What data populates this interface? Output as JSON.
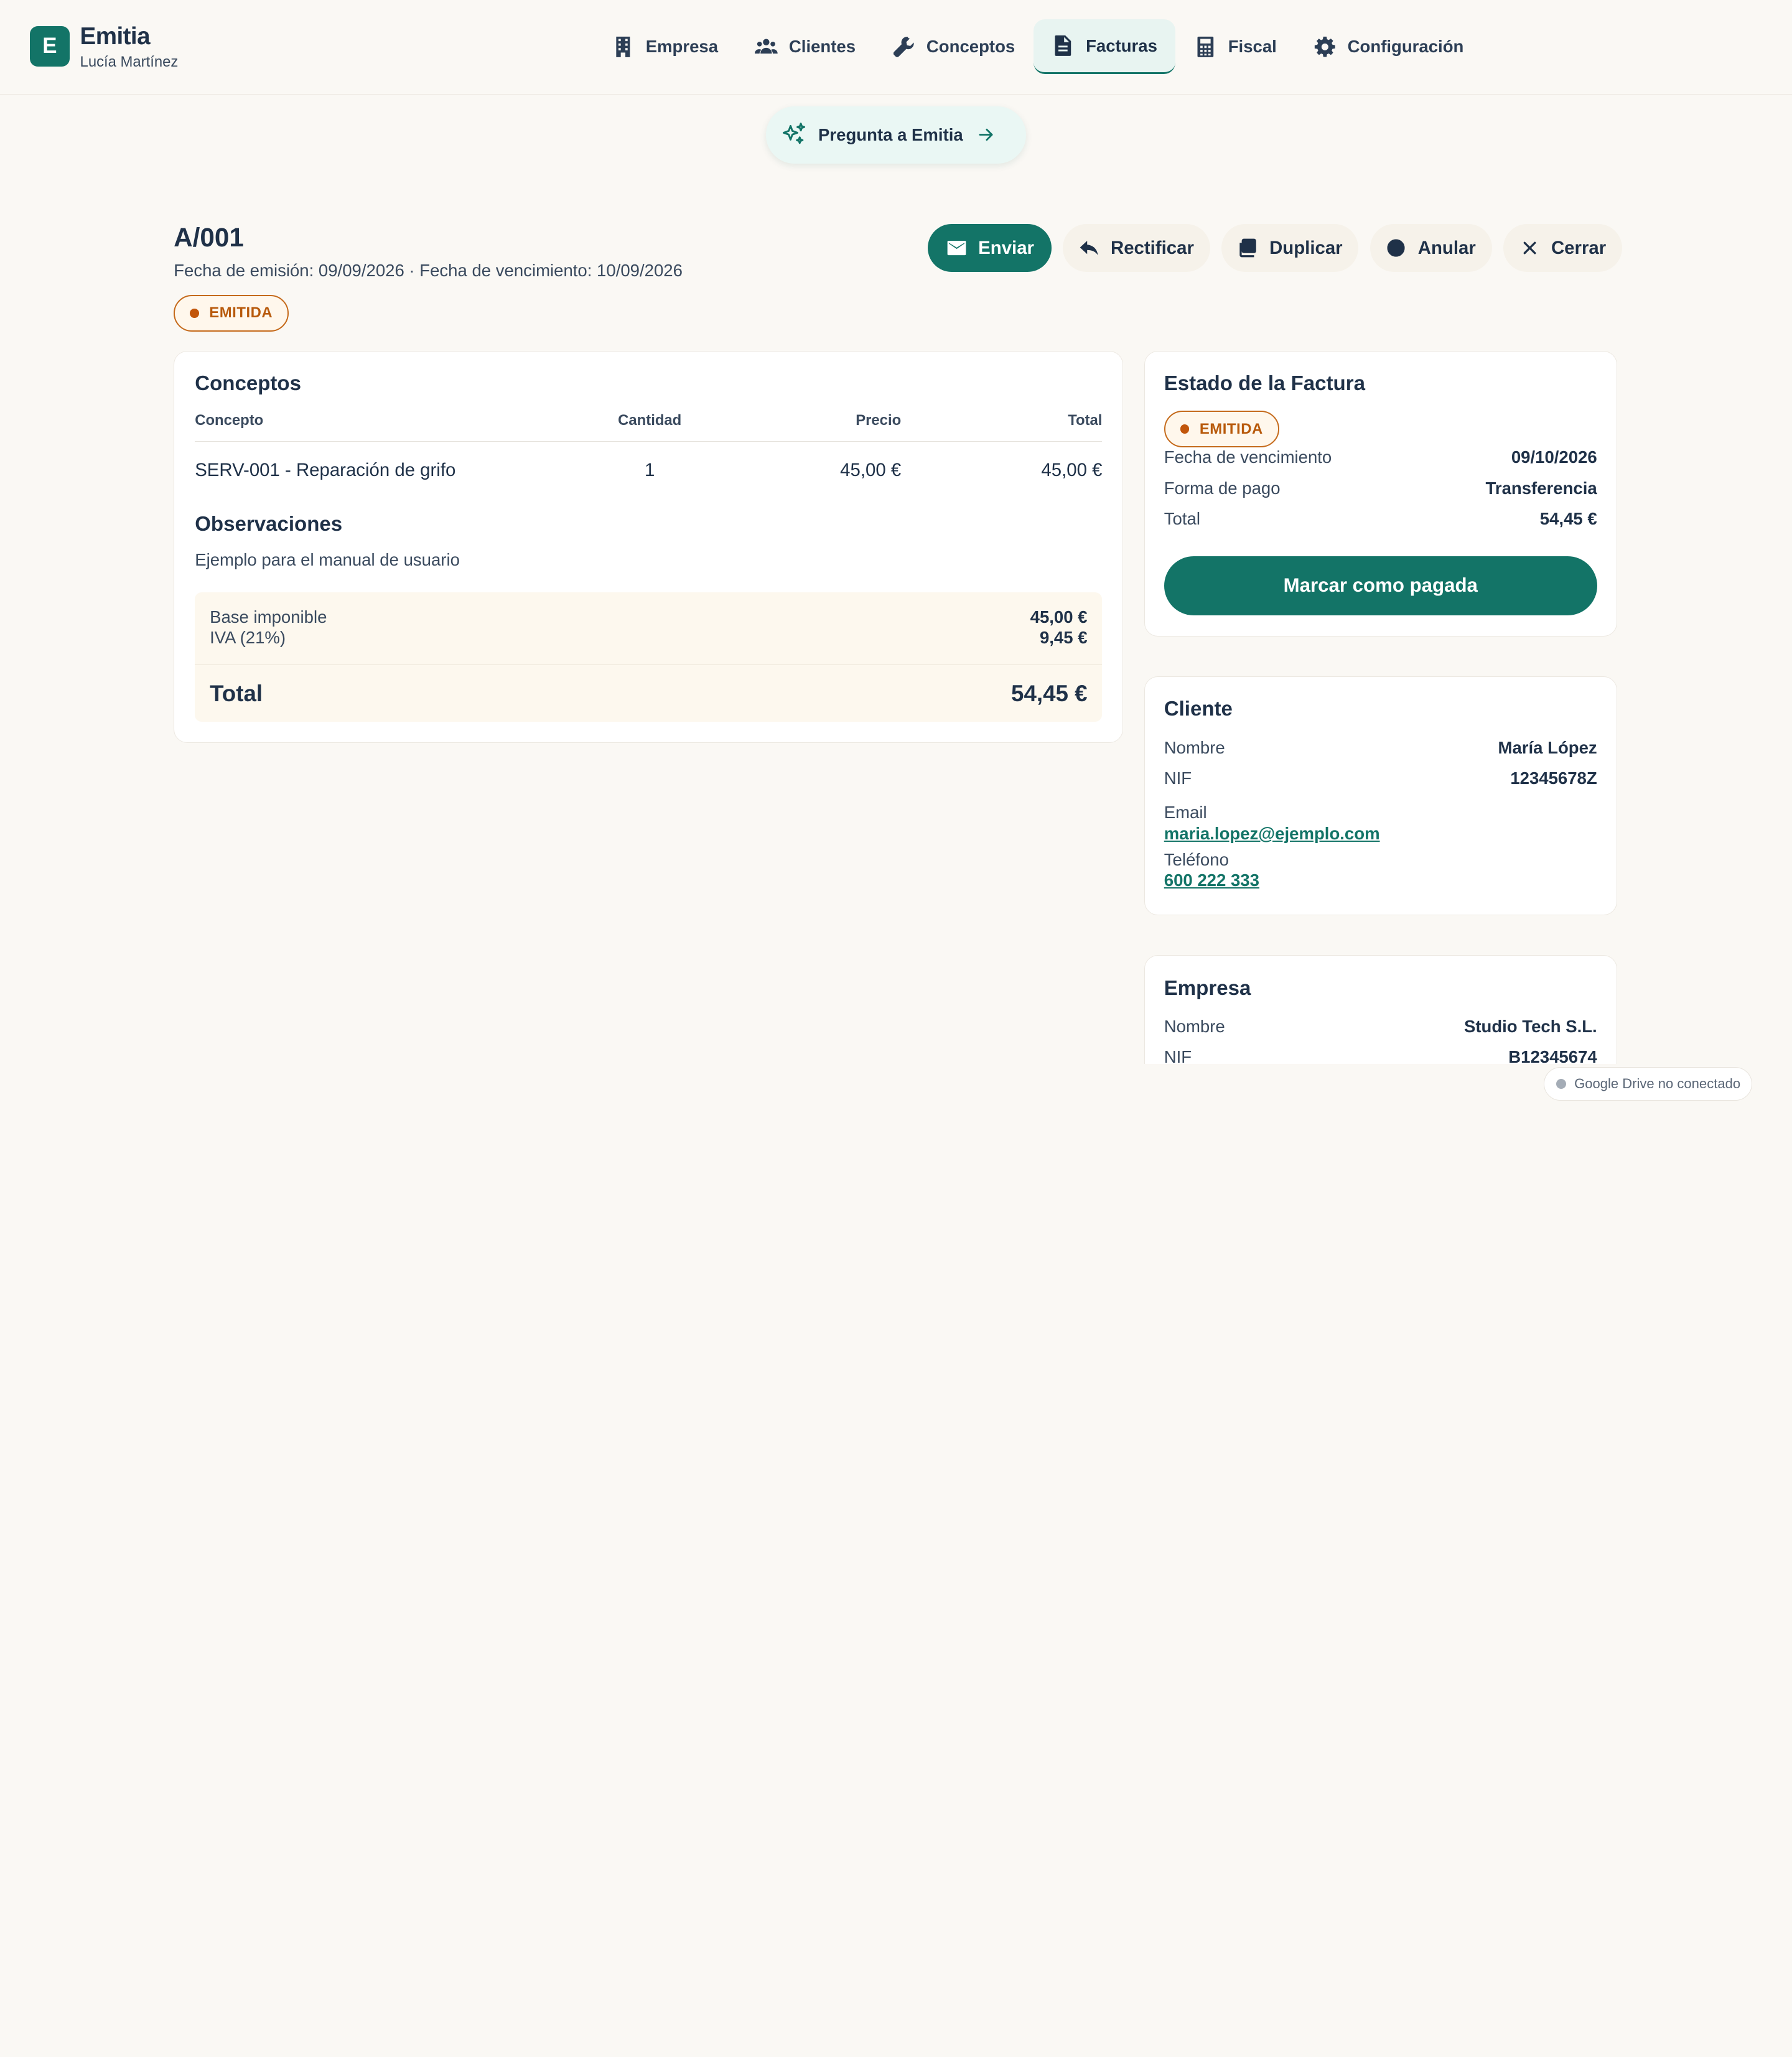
{
  "brand": {
    "logo_letter": "E",
    "name": "Emitia",
    "user": "Lucía Martínez"
  },
  "nav": [
    {
      "label": "Empresa",
      "icon": "building-icon",
      "active": false
    },
    {
      "label": "Clientes",
      "icon": "users-icon",
      "active": false
    },
    {
      "label": "Conceptos",
      "icon": "wrench-icon",
      "active": false
    },
    {
      "label": "Facturas",
      "icon": "document-icon",
      "active": true
    },
    {
      "label": "Fiscal",
      "icon": "calculator-icon",
      "active": false
    },
    {
      "label": "Configuración",
      "icon": "gear-icon",
      "active": false
    }
  ],
  "ask": {
    "label": "Pregunta a Emitia",
    "icon": "sparkles-icon"
  },
  "invoice": {
    "number": "A/001",
    "dates": "Fecha de emisión: 09/09/2026 · Fecha de vencimiento: 10/09/2026",
    "status": "EMITIDA"
  },
  "actions": [
    {
      "label": "Enviar",
      "icon": "mail-icon"
    },
    {
      "label": "Rectificar",
      "icon": "reply-icon"
    },
    {
      "label": "Duplicar",
      "icon": "copy-icon"
    },
    {
      "label": "Anular",
      "icon": "ban-icon"
    },
    {
      "label": "Cerrar",
      "icon": "close-icon"
    }
  ],
  "concepts": {
    "title": "Conceptos",
    "headers": {
      "concept": "Concepto",
      "qty": "Cantidad",
      "price": "Precio",
      "total": "Total"
    },
    "rows": [
      {
        "concept": "SERV-001 - Reparación de grifo",
        "qty": "1",
        "price": "45,00 €",
        "total": "45,00 €"
      }
    ],
    "obs_title": "Observaciones",
    "obs_text": "Ejemplo para el manual de usuario",
    "base_label": "Base imponible",
    "base_value": "45,00 €",
    "iva_label": "IVA (21%)",
    "iva_value": "9,45 €",
    "total_label": "Total",
    "total_value": "54,45 €"
  },
  "status_card": {
    "title": "Estado de la Factura",
    "status": "EMITIDA",
    "due_label": "Fecha de vencimiento",
    "due_value": "09/10/2026",
    "payment_label": "Forma de pago",
    "payment_value": "Transferencia",
    "total_label": "Total",
    "total_value": "54,45 €",
    "pay_button": "Marcar como pagada"
  },
  "client": {
    "title": "Cliente",
    "name_label": "Nombre",
    "name_value": "María López",
    "nif_label": "NIF",
    "nif_value": "12345678Z",
    "email_label": "Email",
    "email_value": "maria.lopez@ejemplo.com",
    "phone_label": "Teléfono",
    "phone_value": "600 222 333"
  },
  "company": {
    "title": "Empresa",
    "name_label": "Nombre",
    "name_value": "Studio Tech S.L.",
    "nif_label": "NIF",
    "nif_value": "B12345674"
  },
  "drive_status": "Google Drive no conectado",
  "colors": {
    "accent": "#137467",
    "status_orange": "#b85a0c",
    "text": "#1f3148",
    "background": "#faf8f4"
  }
}
